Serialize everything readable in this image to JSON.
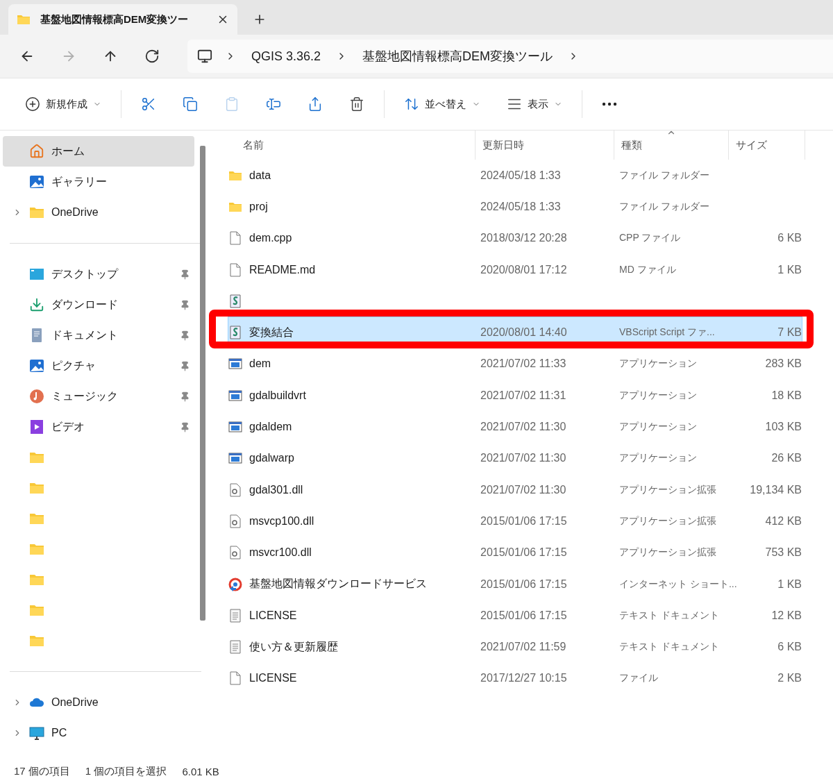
{
  "tab": {
    "title": "基盤地図情報標高DEM変換ツー",
    "selected": true
  },
  "nav": [
    {
      "kind": "back",
      "disabled": false
    },
    {
      "kind": "forward",
      "disabled": true
    },
    {
      "kind": "up",
      "disabled": false
    },
    {
      "kind": "refresh",
      "disabled": false
    }
  ],
  "breadcrumb": [
    "QGIS 3.36.2",
    "基盤地図情報標高DEM変換ツール"
  ],
  "toolbar": [
    {
      "kind": "new",
      "label": "新規作成",
      "disabled": false
    },
    {
      "kind": "cut",
      "disabled": false
    },
    {
      "kind": "copy",
      "disabled": false
    },
    {
      "kind": "paste",
      "disabled": true
    },
    {
      "kind": "rename",
      "disabled": false
    },
    {
      "kind": "share",
      "disabled": false
    },
    {
      "kind": "delete",
      "disabled": false
    },
    {
      "kind": "sort",
      "label": "並べ替え",
      "disabled": false
    },
    {
      "kind": "view",
      "label": "表示",
      "disabled": false
    },
    {
      "kind": "more",
      "disabled": false
    }
  ],
  "sidebar": {
    "groups": [
      [
        {
          "kind": "home",
          "label": "ホーム",
          "selected": true,
          "expandable": false,
          "pinned": false
        },
        {
          "kind": "gallery",
          "label": "ギャラリー",
          "selected": false,
          "expandable": false,
          "pinned": false
        },
        {
          "kind": "folder",
          "label": "OneDrive",
          "selected": false,
          "expandable": true,
          "pinned": false
        }
      ],
      [
        {
          "kind": "desktop",
          "label": "デスクトップ",
          "selected": false,
          "expandable": false,
          "pinned": true
        },
        {
          "kind": "download",
          "label": "ダウンロード",
          "selected": false,
          "expandable": false,
          "pinned": true
        },
        {
          "kind": "document",
          "label": "ドキュメント",
          "selected": false,
          "expandable": false,
          "pinned": true
        },
        {
          "kind": "picture",
          "label": "ピクチャ",
          "selected": false,
          "expandable": false,
          "pinned": true
        },
        {
          "kind": "music",
          "label": "ミュージック",
          "selected": false,
          "expandable": false,
          "pinned": true
        },
        {
          "kind": "video",
          "label": "ビデオ",
          "selected": false,
          "expandable": false,
          "pinned": true
        },
        {
          "kind": "folder",
          "selected": false,
          "expandable": false,
          "pinned": false
        },
        {
          "kind": "folder",
          "selected": false,
          "expandable": false,
          "pinned": false
        },
        {
          "kind": "folder",
          "selected": false,
          "expandable": false,
          "pinned": false
        },
        {
          "kind": "folder",
          "selected": false,
          "expandable": false,
          "pinned": false
        },
        {
          "kind": "folder",
          "selected": false,
          "expandable": false,
          "pinned": false
        },
        {
          "kind": "folder",
          "selected": false,
          "expandable": false,
          "pinned": false
        },
        {
          "kind": "folder",
          "selected": false,
          "expandable": false,
          "pinned": false
        }
      ],
      [
        {
          "kind": "cloud",
          "label": "OneDrive",
          "selected": false,
          "expandable": true,
          "pinned": false
        },
        {
          "kind": "pc",
          "label": "PC",
          "selected": false,
          "expandable": true,
          "pinned": false
        }
      ]
    ]
  },
  "table": {
    "columns": [
      {
        "label": "名前",
        "sorted": false
      },
      {
        "label": "更新日時",
        "sorted": false
      },
      {
        "label": "種類",
        "sorted": true
      },
      {
        "label": "サイズ",
        "sorted": false
      }
    ],
    "rows": [
      {
        "kind": "folder",
        "name": "data",
        "date": "2024/05/18 1:33",
        "type": "ファイル フォルダー",
        "selected": false
      },
      {
        "kind": "folder",
        "name": "proj",
        "date": "2024/05/18 1:33",
        "type": "ファイル フォルダー",
        "selected": false
      },
      {
        "kind": "file",
        "name": "dem.cpp",
        "date": "2018/03/12 20:28",
        "type": "CPP ファイル",
        "size": "6 KB",
        "selected": false
      },
      {
        "kind": "file",
        "name": "README.md",
        "date": "2020/08/01 17:12",
        "type": "MD ファイル",
        "size": "1 KB",
        "selected": false
      },
      {
        "kind": "covered",
        "selected": false
      },
      {
        "kind": "script",
        "name": "変換結合",
        "date": "2020/08/01 14:40",
        "type": "VBScript Script ファ...",
        "size": "7 KB",
        "selected": true
      },
      {
        "kind": "exe",
        "name": "dem",
        "date": "2021/07/02 11:33",
        "type": "アプリケーション",
        "size": "283 KB",
        "selected": false
      },
      {
        "kind": "exe",
        "name": "gdalbuildvrt",
        "date": "2021/07/02 11:31",
        "type": "アプリケーション",
        "size": "18 KB",
        "selected": false
      },
      {
        "kind": "exe",
        "name": "gdaldem",
        "date": "2021/07/02 11:30",
        "type": "アプリケーション",
        "size": "103 KB",
        "selected": false
      },
      {
        "kind": "exe",
        "name": "gdalwarp",
        "date": "2021/07/02 11:30",
        "type": "アプリケーション",
        "size": "26 KB",
        "selected": false
      },
      {
        "kind": "dll",
        "name": "gdal301.dll",
        "date": "2021/07/02 11:30",
        "type": "アプリケーション拡張",
        "size": "19,134 KB",
        "selected": false
      },
      {
        "kind": "dll",
        "name": "msvcp100.dll",
        "date": "2015/01/06 17:15",
        "type": "アプリケーション拡張",
        "size": "412 KB",
        "selected": false
      },
      {
        "kind": "dll",
        "name": "msvcr100.dll",
        "date": "2015/01/06 17:15",
        "type": "アプリケーション拡張",
        "size": "753 KB",
        "selected": false
      },
      {
        "kind": "web",
        "name": "基盤地図情報ダウンロードサービス",
        "date": "2015/01/06 17:15",
        "type": "インターネット ショート...",
        "size": "1 KB",
        "selected": false
      },
      {
        "kind": "text",
        "name": "LICENSE",
        "date": "2015/01/06 17:15",
        "type": "テキスト ドキュメント",
        "size": "12 KB",
        "selected": false
      },
      {
        "kind": "text",
        "name": "使い方＆更新履歴",
        "date": "2021/07/02 11:59",
        "type": "テキスト ドキュメント",
        "size": "6 KB",
        "selected": false
      },
      {
        "kind": "file",
        "name": "LICENSE",
        "date": "2017/12/27 10:15",
        "type": "ファイル",
        "size": "2 KB",
        "selected": false
      }
    ]
  },
  "annotation": {
    "kind": "rectangle"
  },
  "status_bar": [
    "17 個の項目",
    "1 個の項目を選択",
    "6.01 KB"
  ]
}
